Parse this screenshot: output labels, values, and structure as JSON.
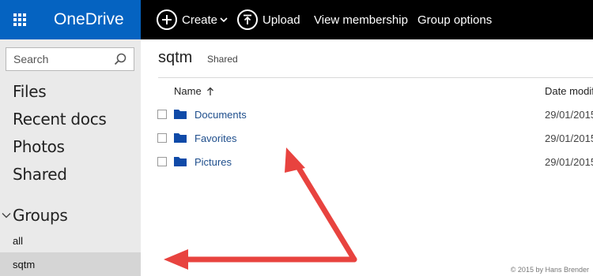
{
  "app": {
    "brand": "OneDrive",
    "accent": "#0563c1"
  },
  "toolbar": {
    "create_label": "Create",
    "upload_label": "Upload",
    "membership_label": "View membership",
    "group_options_label": "Group options"
  },
  "sidebar": {
    "search_placeholder": "Search",
    "items": [
      {
        "label": "Files"
      },
      {
        "label": "Recent docs"
      },
      {
        "label": "Photos"
      },
      {
        "label": "Shared"
      }
    ],
    "groups_label": "Groups",
    "groups": [
      {
        "label": "all"
      },
      {
        "label": "sqtm",
        "selected": true
      }
    ]
  },
  "main": {
    "title": "sqtm",
    "subtitle": "Shared",
    "columns": {
      "name": "Name",
      "date": "Date modified"
    },
    "rows": [
      {
        "name": "Documents",
        "date": "29/01/2015"
      },
      {
        "name": "Favorites",
        "date": "29/01/2015"
      },
      {
        "name": "Pictures",
        "date": "29/01/2015"
      }
    ]
  },
  "footer": {
    "copyright": "© 2015 by Hans Brender"
  },
  "annotation_color": "#e8433f"
}
